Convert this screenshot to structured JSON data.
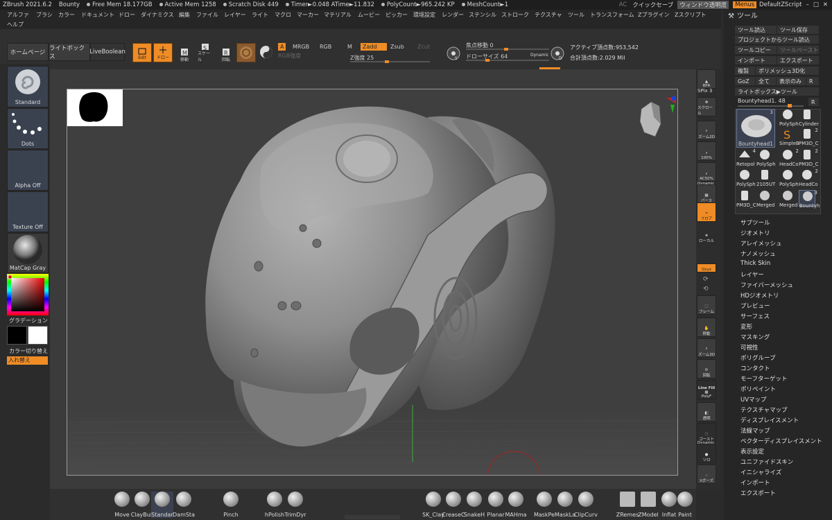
{
  "titlebar": {
    "app": "ZBrush 2021.6.2",
    "project": "Bounty",
    "stats": [
      "Free Mem 18.177GB",
      "Active Mem 1258",
      "Scratch Disk 449",
      "Timer►0.048 ATime►11.832",
      "PolyCount►965.242 KP",
      "MeshCount►1"
    ],
    "ac": "AC",
    "quicksave": "クイックセーブ",
    "window_transparency": "ウィンドウ透明度",
    "menus": "Menus",
    "script": "DefaultZScript"
  },
  "menubar": {
    "items": [
      "アルファ",
      "ブラシ",
      "カラー",
      "ドキュメント",
      "ドロー",
      "ダイナミクス",
      "編集",
      "ファイル",
      "レイヤー",
      "ライト",
      "マクロ",
      "マーカー",
      "マテリアル",
      "ムービー",
      "ピッカー",
      "環境設定",
      "レンダー",
      "ステンシル",
      "ストローク",
      "テクスチャ",
      "ツール",
      "トランスフォーム",
      "Zプラグイン",
      "Zスクリプト"
    ],
    "second_row": [
      "ヘルプ"
    ]
  },
  "panel_title": "ツール",
  "shelf": {
    "home": "ホームページ",
    "lightbox": "ライトボックス",
    "liveboolean": "LiveBoolean",
    "edit": "Edit",
    "draw": "ドロー",
    "move": "移動",
    "scale": "スケール",
    "rotate": "回転",
    "a": "A",
    "mrgb": "MRGB",
    "rgb": "RGB",
    "m": "M",
    "zadd": "Zadd",
    "zsub": "Zsub",
    "zcut": "Zcut",
    "rgb_intensity_label": "RGB強度",
    "z_intensity_label": "Z強度",
    "z_intensity": "25",
    "focal_label": "焦点移動",
    "focal": "0",
    "draw_size_label": "ドローサイズ",
    "draw_size": "64",
    "dynamic": "Dynamic",
    "active_points_label": "アクティブ頂点数:",
    "active_points": "953,542",
    "total_points_label": "合計頂点数:",
    "total_points": "2.029 Mil"
  },
  "left": {
    "brush": "Standard",
    "stroke": "Dots",
    "alpha": "Alpha Off",
    "texture": "Texture Off",
    "material": "MatCap Gray",
    "gradient": "グラデーション",
    "switch_color": "カラー切り替え",
    "swap": "入れ替え"
  },
  "rightshelf": {
    "bpr": "BPR",
    "spix": "SPix 3",
    "scroll": "スクロール",
    "zoom2d": "ズーム2D",
    "pct100": "100%",
    "ac50": "AC50%",
    "dynamic": "Dynamic",
    "persp": "パース",
    "floor": "フロア",
    "local": "ローカル",
    "xyz": "Qxyz",
    "frame": "フレーム",
    "move": "移動",
    "zoom3d": "ズーム3D",
    "rotate": "回転",
    "linefill": "Line Fill",
    "polyf": "PolyF",
    "transp": "透明",
    "ghost": "ゴースト",
    "solo": "ソロ",
    "dynamic2": "Dynamic",
    "xpose": "Xポーズ"
  },
  "toolpanel": {
    "load_tool": "ツール読込",
    "save_tool": "ツール保存",
    "load_from_project": "プロジェクトからツール読込",
    "copy_tool": "ツールコピー",
    "paste_tool": "ツールペースト",
    "import": "インポート",
    "export": "エクスポート",
    "clone": "複製",
    "make_polymesh": "ポリメッシュ3D化",
    "goz": "GoZ",
    "all": "全て",
    "visible_only": "表示のみ",
    "r": "R",
    "lightbox_tool": "ライトボックス▶ツール",
    "current_tool": "Bountyhead1.",
    "current_value": "48",
    "r2": "R",
    "main_tool_label": "Bountyhead1",
    "main_tool_count": "3",
    "tools": [
      {
        "name": "PolySph",
        "count": ""
      },
      {
        "name": "Cylinder",
        "count": ""
      },
      {
        "name": "SimpleB",
        "count": ""
      },
      {
        "name": "PM3D_C",
        "count": "2"
      },
      {
        "name": "Retopol",
        "count": "4"
      },
      {
        "name": "PolySph",
        "count": ""
      },
      {
        "name": "HeadCo",
        "count": "2"
      },
      {
        "name": "PM3D_C",
        "count": "2"
      },
      {
        "name": "PolySph",
        "count": ""
      },
      {
        "name": "2105UT",
        "count": ""
      },
      {
        "name": "PolySph",
        "count": ""
      },
      {
        "name": "HeadCo",
        "count": "2"
      },
      {
        "name": "PM3D_C",
        "count": ""
      },
      {
        "name": "Merged",
        "count": ""
      },
      {
        "name": "Merged",
        "count": ""
      },
      {
        "name": "Bountyh",
        "count": "3"
      }
    ],
    "subpalettes": [
      "サブツール",
      "ジオメトリ",
      "アレイメッシュ",
      "ナノメッシュ",
      "Thick Skin",
      "レイヤー",
      "ファイバーメッシュ",
      "HDジオメトリ",
      "プレビュー",
      "サーフェス",
      "変形",
      "マスキング",
      "可視性",
      "ポリグループ",
      "コンタクト",
      "モーフターゲット",
      "ポリペイント",
      "UVマップ",
      "テクスチャマップ",
      "ディスプレイスメント",
      "法線マップ",
      "ベクターディスプレイスメント",
      "表示設定",
      "ユニファイドスキン",
      "イニシャライズ",
      "インポート",
      "エクスポート"
    ]
  },
  "bottomshelf": {
    "brushes": [
      "Move",
      "ClayBuil",
      "Standar",
      "DamSta",
      "Pinch",
      "hPolish",
      "TrimDyr",
      "SK_Clay",
      "CreaseC",
      "SnakeH",
      "Planar",
      "MAHma",
      "MaskPe",
      "MaskLa",
      "ClipCurv",
      "ZRemes",
      "ZModel",
      "Inflat",
      "Paint"
    ]
  },
  "colors": {
    "accent": "#ef8c26",
    "bg": "#2b2b2b",
    "canvas": "#3f3f3f"
  }
}
